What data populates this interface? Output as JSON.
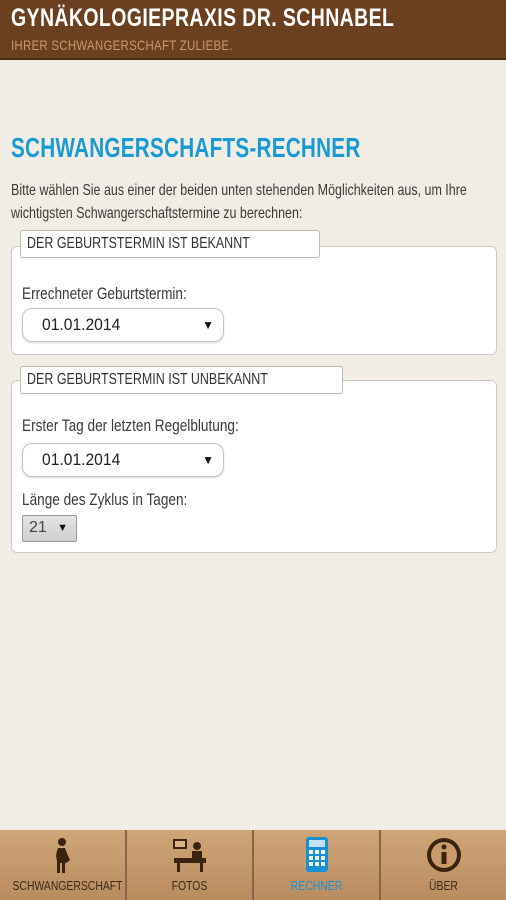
{
  "header": {
    "title": "GYNÄKOLOGIEPRAXIS DR. SCHNABEL",
    "subtitle": "IHRER SCHWANGERSCHAFT ZULIEBE."
  },
  "main": {
    "title": "SCHWANGERSCHAFTS-RECHNER",
    "intro": "Bitte wählen Sie aus einer der beiden unten stehenden Möglichkeiten aus, um Ihre wichtigsten Schwangerschaftstermine zu berechnen:",
    "known": {
      "legend": "DER GEBURTSTERMIN IST BEKANNT",
      "label": "Errechneter Geburtstermin:",
      "value": "01.01.2014"
    },
    "unknown": {
      "legend": "DER GEBURTSTERMIN IST UNBEKANNT",
      "period_label": "Erster Tag der letzten Regelblutung:",
      "period_value": "01.01.2014",
      "cycle_label": "Länge des Zyklus in Tagen:",
      "cycle_value": "21"
    }
  },
  "tabs": [
    {
      "label": "SCHWANGERSCHAFT",
      "icon": "pregnant-woman-icon"
    },
    {
      "label": "FOTOS",
      "icon": "ultrasound-icon"
    },
    {
      "label": "RECHNER",
      "icon": "calculator-icon",
      "active": true
    },
    {
      "label": "ÜBER",
      "icon": "info-icon"
    }
  ],
  "colors": {
    "header_bg": "#6b4020",
    "accent": "#1a9ad4",
    "tabbar_bg": "#c3986b",
    "page_bg": "#f1ede4"
  }
}
